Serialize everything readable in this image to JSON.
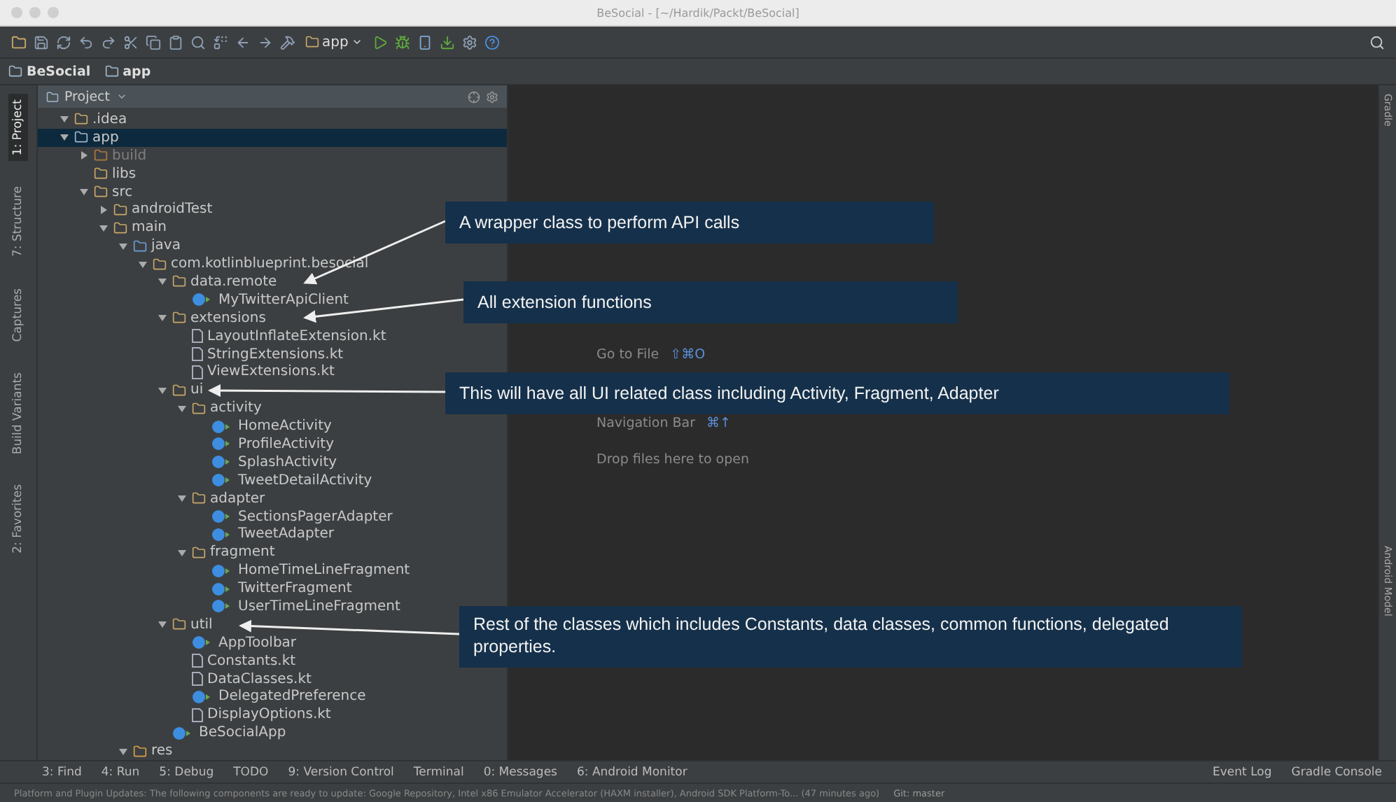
{
  "window": {
    "title": "BeSocial - [~/Hardik/Packt/BeSocial]"
  },
  "toolbar": {
    "run_config": "app"
  },
  "breadcrumbs": [
    {
      "label": "BeSocial"
    },
    {
      "label": "app"
    }
  ],
  "left_tool_tabs": [
    {
      "label": "1: Project",
      "selected": true
    },
    {
      "label": "7: Structure",
      "selected": false
    },
    {
      "label": "Captures",
      "selected": false
    },
    {
      "label": "Build Variants",
      "selected": false
    },
    {
      "label": "2: Favorites",
      "selected": false
    }
  ],
  "right_tool_tabs": [
    {
      "label": "Gradle"
    },
    {
      "label": "Android Model"
    }
  ],
  "project_panel": {
    "title": "Project",
    "tree": [
      {
        "label": ".idea",
        "kind": "folder",
        "expanded": true,
        "selected": false
      },
      {
        "label": "app",
        "kind": "module",
        "expanded": true,
        "selected": true,
        "children": [
          {
            "label": "build",
            "kind": "excluded",
            "expanded": false,
            "selected": false
          },
          {
            "label": "libs",
            "kind": "folder",
            "selected": false
          },
          {
            "label": "src",
            "kind": "folder",
            "expanded": true,
            "selected": false,
            "children": [
              {
                "label": "androidTest",
                "kind": "folder",
                "expanded": false,
                "selected": false
              },
              {
                "label": "main",
                "kind": "folder",
                "expanded": true,
                "selected": false,
                "children": [
                  {
                    "label": "java",
                    "kind": "source",
                    "expanded": true,
                    "selected": false,
                    "children": [
                      {
                        "label": "com.kotlinblueprint.besocial",
                        "kind": "package",
                        "expanded": true,
                        "selected": false,
                        "children": [
                          {
                            "label": "data.remote",
                            "kind": "package",
                            "expanded": true,
                            "selected": false,
                            "children": [
                              {
                                "label": "MyTwitterApiClient",
                                "kind": "class",
                                "selected": false
                              }
                            ]
                          },
                          {
                            "label": "extensions",
                            "kind": "package",
                            "expanded": true,
                            "selected": false,
                            "children": [
                              {
                                "label": "LayoutInflateExtension.kt",
                                "kind": "file",
                                "selected": false
                              },
                              {
                                "label": "StringExtensions.kt",
                                "kind": "file",
                                "selected": false
                              },
                              {
                                "label": "ViewExtensions.kt",
                                "kind": "file",
                                "selected": false
                              }
                            ]
                          },
                          {
                            "label": "ui",
                            "kind": "package",
                            "expanded": true,
                            "selected": false,
                            "children": [
                              {
                                "label": "activity",
                                "kind": "package",
                                "expanded": true,
                                "selected": false,
                                "children": [
                                  {
                                    "label": "HomeActivity",
                                    "kind": "class",
                                    "selected": false
                                  },
                                  {
                                    "label": "ProfileActivity",
                                    "kind": "class",
                                    "selected": false
                                  },
                                  {
                                    "label": "SplashActivity",
                                    "kind": "class",
                                    "selected": false
                                  },
                                  {
                                    "label": "TweetDetailActivity",
                                    "kind": "class",
                                    "selected": false
                                  }
                                ]
                              },
                              {
                                "label": "adapter",
                                "kind": "package",
                                "expanded": true,
                                "selected": false,
                                "children": [
                                  {
                                    "label": "SectionsPagerAdapter",
                                    "kind": "class",
                                    "selected": false
                                  },
                                  {
                                    "label": "TweetAdapter",
                                    "kind": "class",
                                    "selected": false
                                  }
                                ]
                              },
                              {
                                "label": "fragment",
                                "kind": "package",
                                "expanded": true,
                                "selected": false,
                                "children": [
                                  {
                                    "label": "HomeTimeLineFragment",
                                    "kind": "class",
                                    "selected": false
                                  },
                                  {
                                    "label": "TwitterFragment",
                                    "kind": "class",
                                    "selected": false
                                  },
                                  {
                                    "label": "UserTimeLineFragment",
                                    "kind": "class",
                                    "selected": false
                                  }
                                ]
                              }
                            ]
                          },
                          {
                            "label": "util",
                            "kind": "package",
                            "expanded": true,
                            "selected": false,
                            "children": [
                              {
                                "label": "AppToolbar",
                                "kind": "class",
                                "selected": false
                              },
                              {
                                "label": "Constants.kt",
                                "kind": "file",
                                "selected": false
                              },
                              {
                                "label": "DataClasses.kt",
                                "kind": "file",
                                "selected": false
                              },
                              {
                                "label": "DelegatedPreference",
                                "kind": "class",
                                "selected": false
                              },
                              {
                                "label": "DisplayOptions.kt",
                                "kind": "file",
                                "selected": false
                              }
                            ]
                          },
                          {
                            "label": "BeSocialApp",
                            "kind": "class",
                            "selected": false
                          }
                        ]
                      }
                    ]
                  },
                  {
                    "label": "res",
                    "kind": "resources",
                    "expanded": true,
                    "selected": false
                  }
                ]
              }
            ]
          }
        ]
      }
    ]
  },
  "editor_hints": [
    {
      "label": "Go to File",
      "shortcut": "⇧⌘O"
    },
    {
      "label": "Navigation Bar",
      "shortcut": "⌘↑"
    },
    {
      "label": "Drop files here to open"
    }
  ],
  "annotations": [
    {
      "text": "A wrapper class to perform API calls"
    },
    {
      "text": "All extension functions"
    },
    {
      "text": "This will have all UI related class including Activity, Fragment, Adapter"
    },
    {
      "text": "Rest of the classes which includes Constants, data classes, common functions, delegated properties."
    }
  ],
  "bottom_tool_tabs": [
    {
      "label": "3: Find"
    },
    {
      "label": "4: Run"
    },
    {
      "label": "5: Debug"
    },
    {
      "label": "TODO"
    },
    {
      "label": "9: Version Control"
    },
    {
      "label": "Terminal"
    },
    {
      "label": "0: Messages"
    },
    {
      "label": "6: Android Monitor"
    }
  ],
  "bottom_right_tabs": [
    {
      "label": "Event Log"
    },
    {
      "label": "Gradle Console"
    }
  ],
  "status_bar": {
    "message": "Platform and Plugin Updates: The following components are ready to update: Google Repository, Intel x86 Emulator Accelerator (HAXM installer), Android SDK Platform-To... (47 minutes ago)",
    "vcs": "Git: master"
  }
}
